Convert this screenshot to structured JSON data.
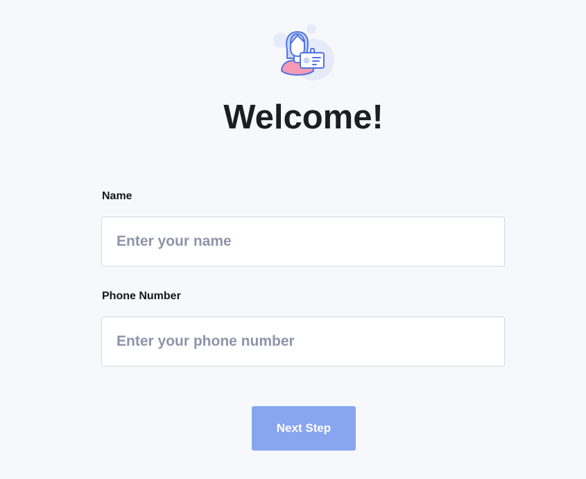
{
  "header": {
    "illustration_icon": "user-id-badge-icon",
    "title": "Welcome!"
  },
  "form": {
    "name": {
      "label": "Name",
      "value": "",
      "placeholder": "Enter your name"
    },
    "phone": {
      "label": "Phone Number",
      "value": "",
      "placeholder": "Enter your phone number"
    },
    "submit_label": "Next Step"
  },
  "colors": {
    "page_background": "#f7f8fc",
    "button_background": "#88a5f0",
    "illustration_accent": "#4f73e3",
    "illustration_pink": "#f59bb3",
    "title_text": "#1d1d24"
  }
}
